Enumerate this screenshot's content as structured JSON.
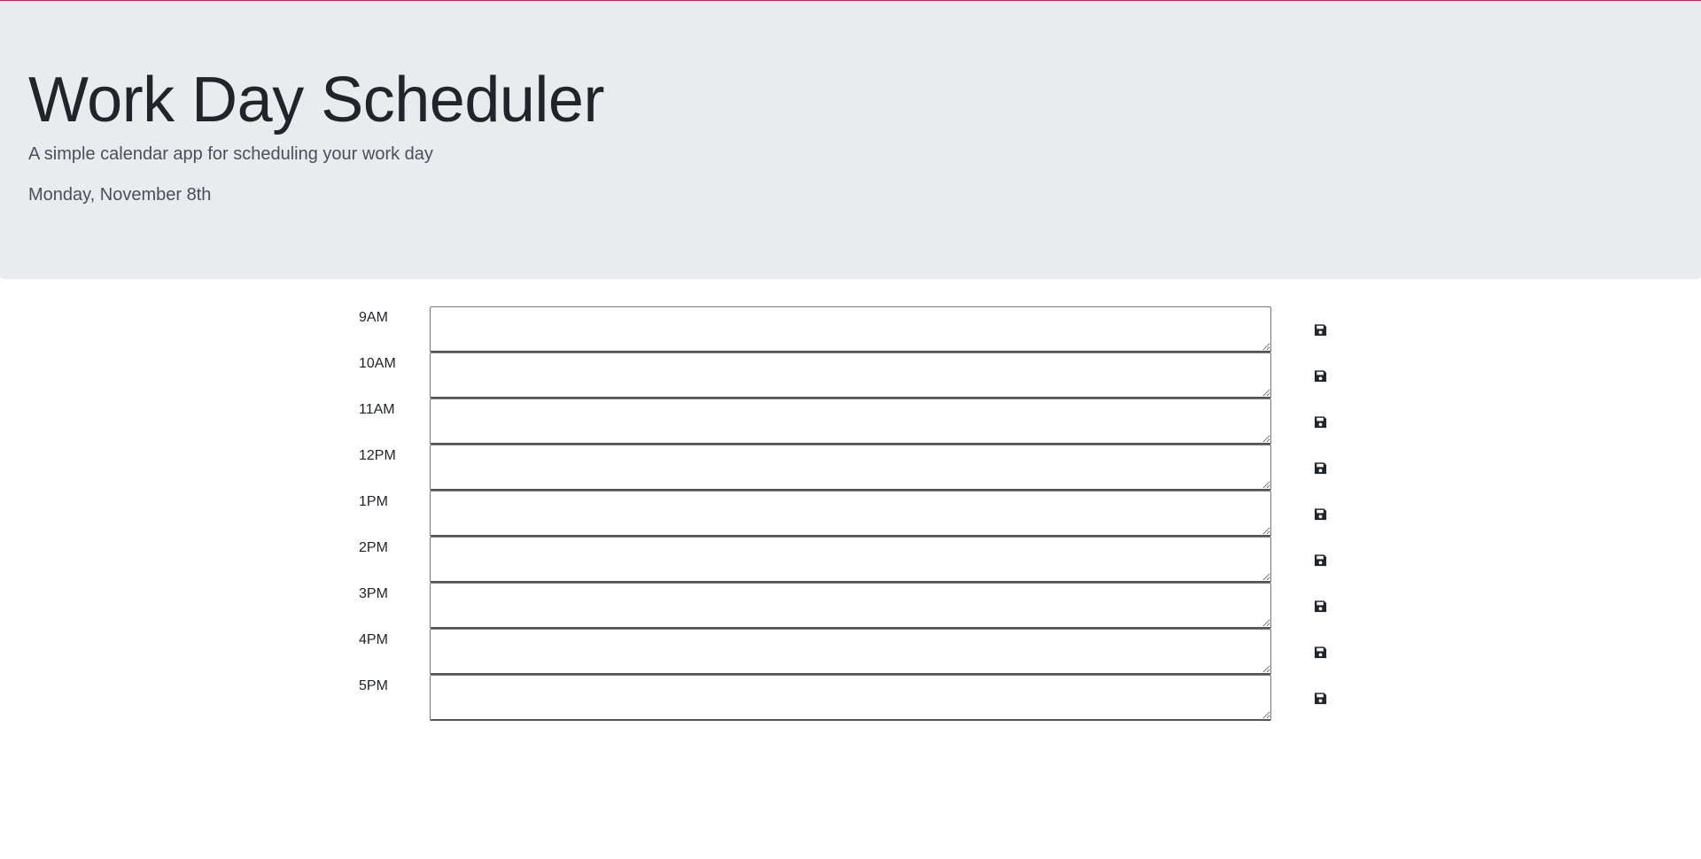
{
  "header": {
    "title": "Work Day Scheduler",
    "subtitle": "A simple calendar app for scheduling your work day",
    "current_day": "Monday, November 8th"
  },
  "schedule": {
    "blocks": [
      {
        "hour": "9AM",
        "value": ""
      },
      {
        "hour": "10AM",
        "value": ""
      },
      {
        "hour": "11AM",
        "value": ""
      },
      {
        "hour": "12PM",
        "value": ""
      },
      {
        "hour": "1PM",
        "value": ""
      },
      {
        "hour": "2PM",
        "value": ""
      },
      {
        "hour": "3PM",
        "value": ""
      },
      {
        "hour": "4PM",
        "value": ""
      },
      {
        "hour": "5PM",
        "value": ""
      }
    ],
    "save_icon": "floppy-disk-icon"
  },
  "colors": {
    "header_bg": "#e9ecef",
    "top_border": "#b03060",
    "text": "#212529"
  }
}
